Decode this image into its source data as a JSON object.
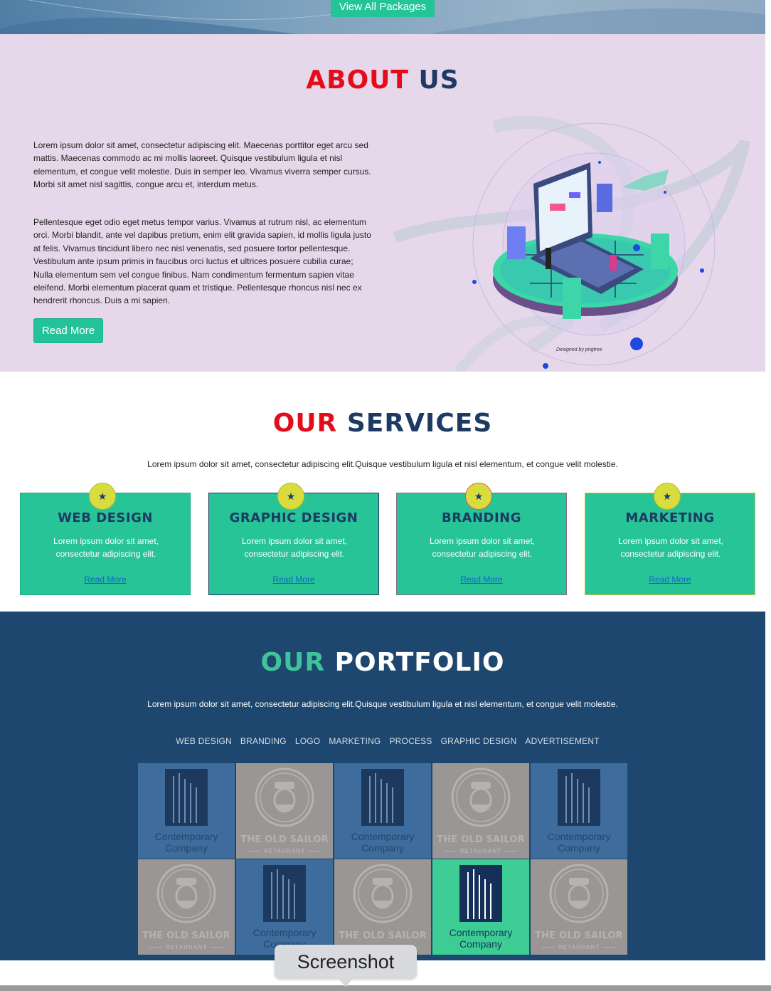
{
  "hero": {
    "view_all_label": "View All Packages"
  },
  "about": {
    "title_part1": "ABOUT",
    "title_part2": "US",
    "paragraph1": "Lorem ipsum dolor sit amet, consectetur adipiscing elit. Maecenas porttitor eget arcu sed mattis. Maecenas commodo ac mi mollis laoreet. Quisque vestibulum ligula et nisl elementum, et congue velit molestie. Duis in semper leo. Vivamus viverra semper cursus. Morbi sit amet nisl sagittis, congue arcu et, interdum metus.",
    "paragraph2": "Pellentesque eget odio eget metus tempor varius. Vivamus at rutrum nisl, ac elementum orci. Morbi blandit, ante vel dapibus pretium, enim elit gravida sapien, id mollis ligula justo at felis. Vivamus tincidunt libero nec nisl venenatis, sed posuere tortor pellentesque. Vestibulum ante ipsum primis in faucibus orci luctus et ultrices posuere cubilia curae; Nulla elementum sem vel congue finibus. Nam condimentum fermentum sapien vitae eleifend. Morbi elementum placerat quam et tristique. Pellentesque rhoncus nisl nec ex hendrerit rhoncus. Duis a mi sapien.",
    "read_more_label": "Read More",
    "designed_by": "Designed by pngtree"
  },
  "services": {
    "title_part1": "OUR",
    "title_part2": "SERVICES",
    "subtitle": "Lorem ipsum dolor sit amet, consectetur adipiscing elit.Quisque vestibulum ligula et nisl elementum, et congue velit molestie.",
    "cards": [
      {
        "title": "WEB DESIGN",
        "text": "Lorem ipsum dolor sit amet, consectetur adipiscing elit.",
        "link": "Read More",
        "icon": "star-icon",
        "badge_border": "#b7ba2a",
        "card_border": "#1fa983"
      },
      {
        "title": "GRAPHIC DESIGN",
        "text": "Lorem ipsum dolor sit amet, consectetur adipiscing elit.",
        "link": "Read More",
        "icon": "star-icon",
        "badge_border": "#b7ba2a",
        "card_border": "#1d3a63"
      },
      {
        "title": "BRANDING",
        "text": "Lorem ipsum dolor sit amet, consectetur adipiscing elit.",
        "link": "Read More",
        "icon": "star-icon",
        "badge_border": "#e5574e",
        "card_border": "#8a6a8a"
      },
      {
        "title": "MARKETING",
        "text": "Lorem ipsum dolor sit amet, consectetur adipiscing elit.",
        "link": "Read More",
        "icon": "star-icon",
        "badge_border": "#b7ba2a",
        "card_border": "#c9c235"
      }
    ]
  },
  "portfolio": {
    "title_part1": "OUR",
    "title_part2": "PORTFOLIO",
    "subtitle": "Lorem ipsum dolor sit amet, consectetur adipiscing elit.Quisque vestibulum ligula et nisl elementum, et congue velit molestie.",
    "filters": [
      "WEB DESIGN",
      "BRANDING",
      "LOGO",
      "MARKETING",
      "PROCESS",
      "GRAPHIC DESIGN",
      "ADVERTISEMENT"
    ],
    "tiles": [
      {
        "kind": "building",
        "bg": "blue",
        "name_line1": "Contemporary",
        "name_line2": "Company"
      },
      {
        "kind": "sailor",
        "bg": "gray",
        "name": "THE OLD SAILOR",
        "sub": "RETAURANT"
      },
      {
        "kind": "building",
        "bg": "blue",
        "name_line1": "Contemporary",
        "name_line2": "Company"
      },
      {
        "kind": "sailor",
        "bg": "gray",
        "name": "THE OLD SAILOR",
        "sub": "RETAURANT"
      },
      {
        "kind": "building",
        "bg": "blue",
        "name_line1": "Contemporary",
        "name_line2": "Company"
      },
      {
        "kind": "sailor",
        "bg": "gray",
        "name": "THE OLD SAILOR",
        "sub": "RETAURANT"
      },
      {
        "kind": "building",
        "bg": "blue",
        "name_line1": "Contemporary",
        "name_line2": "Company"
      },
      {
        "kind": "sailor",
        "bg": "gray",
        "name": "THE OLD SAILOR",
        "sub": "RETAURANT"
      },
      {
        "kind": "building",
        "bg": "green",
        "name_line1": "Contemporary",
        "name_line2": "Company"
      },
      {
        "kind": "sailor",
        "bg": "gray",
        "name": "THE OLD SAILOR",
        "sub": "RETAURANT"
      }
    ]
  },
  "tooltip": {
    "label": "Screenshot"
  },
  "colors": {
    "accent_green": "#23c495",
    "title_red": "#e40b1b",
    "navy": "#1d3a63",
    "portfolio_bg": "#1d476e",
    "about_bg": "#e6d8ea"
  }
}
